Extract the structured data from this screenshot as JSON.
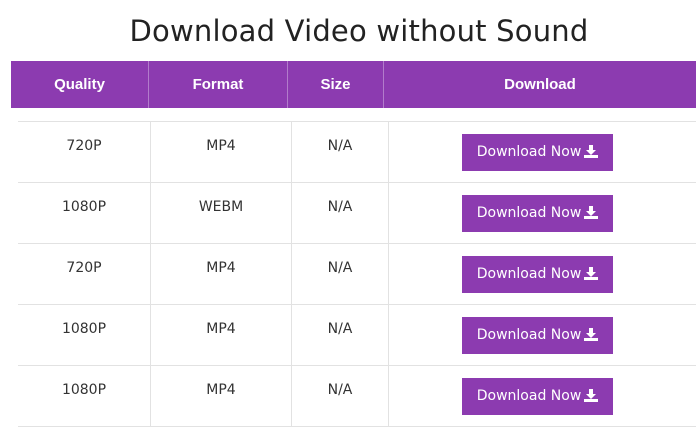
{
  "page": {
    "title": "Download Video without Sound"
  },
  "table": {
    "headers": {
      "quality": "Quality",
      "format": "Format",
      "size": "Size",
      "download": "Download"
    },
    "rows": [
      {
        "quality": "720P",
        "format": "MP4",
        "size": "N/A",
        "download_label": "Download Now"
      },
      {
        "quality": "1080P",
        "format": "WEBM",
        "size": "N/A",
        "download_label": "Download Now"
      },
      {
        "quality": "720P",
        "format": "MP4",
        "size": "N/A",
        "download_label": "Download Now"
      },
      {
        "quality": "1080P",
        "format": "MP4",
        "size": "N/A",
        "download_label": "Download Now"
      },
      {
        "quality": "1080P",
        "format": "MP4",
        "size": "N/A",
        "download_label": "Download Now"
      }
    ]
  },
  "icons": {
    "download_icon": "download-icon"
  },
  "colors": {
    "accent": "#8c3bb0",
    "header_text": "#ffffff",
    "body_text": "#333333",
    "divider": "#e2e2e2"
  }
}
